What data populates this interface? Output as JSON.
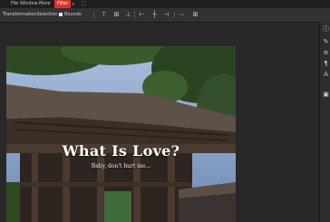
{
  "menubar": {
    "items": [
      {
        "label": "File"
      },
      {
        "label": "Window"
      },
      {
        "label": "More"
      },
      {
        "label": "Filter"
      }
    ]
  },
  "options": {
    "transform_label": "TransformationSelection",
    "bounds_label": "Bounds"
  },
  "canvas": {
    "title": "What Is Love?",
    "subtitle": "Baby, don't hurt me..."
  },
  "colors": {
    "accent": "#d9342b",
    "panel": "#282828",
    "sky": "#8aa3c8",
    "roof": "#5e5148",
    "foliage": "#3a5a2c"
  }
}
